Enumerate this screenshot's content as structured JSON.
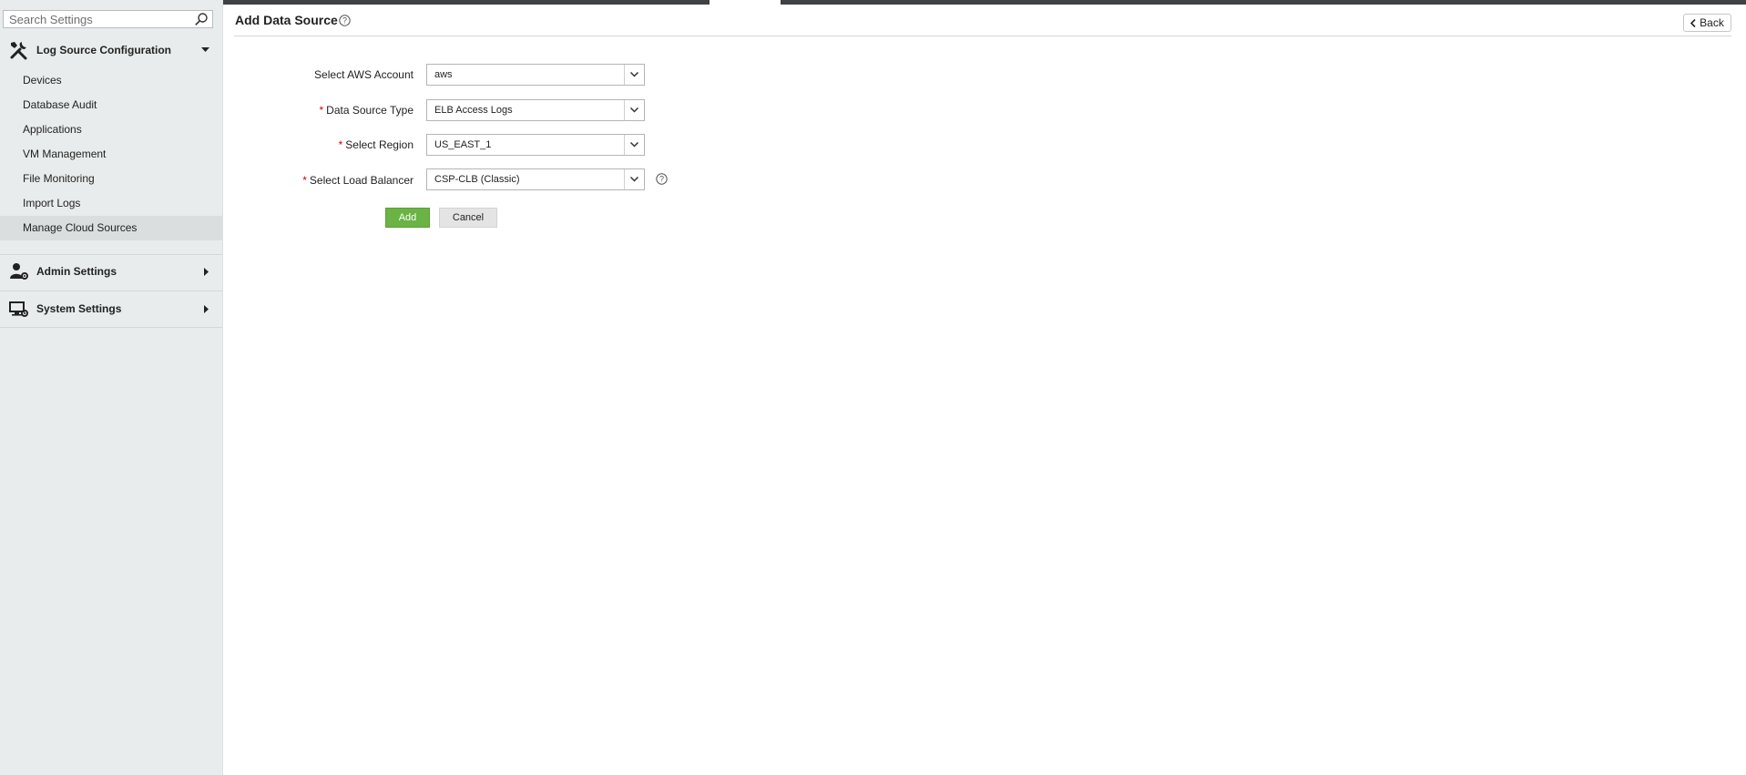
{
  "sidebar": {
    "search_placeholder": "Search Settings",
    "groups": [
      {
        "label": "Log Source Configuration",
        "icon": "tools-icon",
        "expanded": true,
        "items": [
          {
            "label": "Devices"
          },
          {
            "label": "Database Audit"
          },
          {
            "label": "Applications"
          },
          {
            "label": "VM Management"
          },
          {
            "label": "File Monitoring"
          },
          {
            "label": "Import Logs"
          },
          {
            "label": "Manage Cloud Sources",
            "active": true
          }
        ]
      },
      {
        "label": "Admin Settings",
        "icon": "admin-user-gear-icon",
        "expanded": false
      },
      {
        "label": "System Settings",
        "icon": "monitor-gear-icon",
        "expanded": false
      }
    ]
  },
  "header": {
    "title": "Add Data Source",
    "back_label": "Back"
  },
  "form": {
    "fields": [
      {
        "label": "Select AWS Account",
        "required": false,
        "value": "aws"
      },
      {
        "label": "Data Source Type",
        "required": true,
        "value": "ELB Access Logs"
      },
      {
        "label": "Select Region",
        "required": true,
        "value": "US_EAST_1"
      },
      {
        "label": "Select Load Balancer",
        "required": true,
        "value": "CSP-CLB (Classic)"
      }
    ],
    "required_marker": "*",
    "add_label": "Add",
    "cancel_label": "Cancel"
  },
  "colors": {
    "accent_green": "#6ab344",
    "required_red": "#d40000",
    "sidebar_bg": "#e9ecec"
  }
}
